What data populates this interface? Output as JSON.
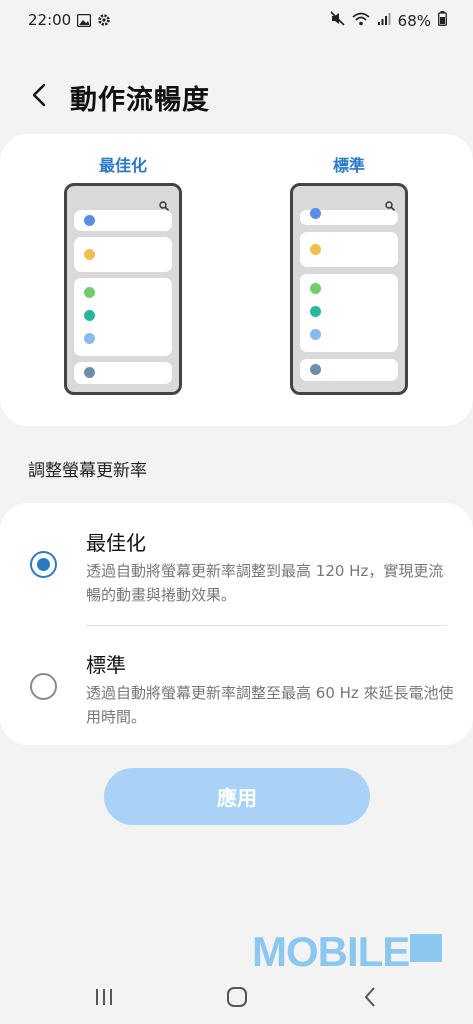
{
  "status_bar": {
    "time": "22:00",
    "battery": "68%"
  },
  "header": {
    "title": "動作流暢度"
  },
  "preview": {
    "left_label": "最佳化",
    "right_label": "標準"
  },
  "section": {
    "title": "調整螢幕更新率"
  },
  "options": [
    {
      "title": "最佳化",
      "description": "透過自動將螢幕更新率調整到最高 120 Hz，實現更流暢的動畫與捲動效果。",
      "selected": true
    },
    {
      "title": "標準",
      "description": "透過自動將螢幕更新率調整至最高 60 Hz 來延長電池使用時間。",
      "selected": false
    }
  ],
  "apply_button": {
    "label": "應用"
  },
  "watermark": {
    "text": "MOBILE"
  },
  "colors": {
    "accent": "#2a7ac7",
    "apply_bg": "#a9d2f6"
  }
}
